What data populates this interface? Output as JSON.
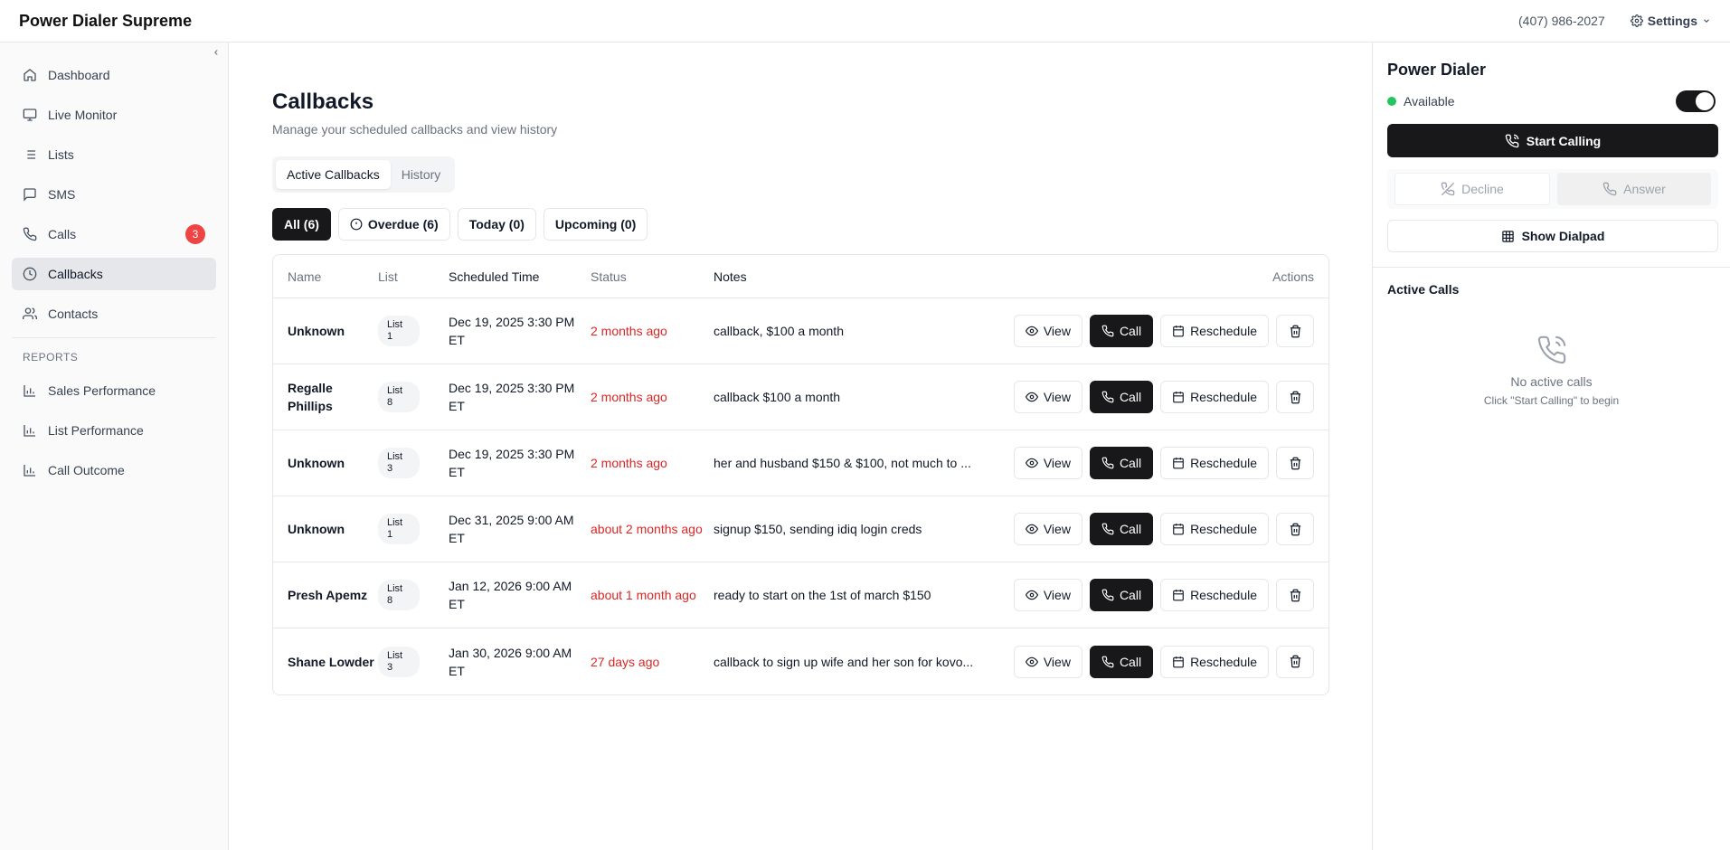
{
  "app": {
    "title": "Power Dialer Supreme"
  },
  "header": {
    "phone": "(407) 986-2027",
    "settings_label": "Settings"
  },
  "sidebar": {
    "items": [
      {
        "label": "Dashboard",
        "icon": "home-icon"
      },
      {
        "label": "Live Monitor",
        "icon": "monitor-icon"
      },
      {
        "label": "Lists",
        "icon": "list-icon"
      },
      {
        "label": "SMS",
        "icon": "message-icon"
      },
      {
        "label": "Calls",
        "icon": "phone-icon",
        "badge": "3"
      },
      {
        "label": "Callbacks",
        "icon": "clock-icon",
        "active": true
      },
      {
        "label": "Contacts",
        "icon": "users-icon"
      }
    ],
    "reports_label": "REPORTS",
    "reports": [
      {
        "label": "Sales Performance",
        "icon": "bar-chart-icon"
      },
      {
        "label": "List Performance",
        "icon": "bar-chart-icon"
      },
      {
        "label": "Call Outcome",
        "icon": "bar-chart-icon"
      }
    ]
  },
  "main": {
    "title": "Callbacks",
    "subtitle": "Manage your scheduled callbacks and view history",
    "tabs": [
      {
        "label": "Active Callbacks",
        "active": true
      },
      {
        "label": "History"
      }
    ],
    "filters": [
      {
        "label": "All (6)",
        "active": true
      },
      {
        "label": "Overdue (6)",
        "icon": "alert-circle-icon"
      },
      {
        "label": "Today (0)"
      },
      {
        "label": "Upcoming (0)"
      }
    ],
    "table": {
      "headers": {
        "name": "Name",
        "list": "List",
        "time": "Scheduled Time",
        "status": "Status",
        "notes": "Notes",
        "actions": "Actions"
      },
      "rows": [
        {
          "name": "Unknown",
          "list": "List 1",
          "time": "Dec 19, 2025 3:30 PM ET",
          "status": "2 months ago",
          "notes": "callback, $100 a month"
        },
        {
          "name": "Regalle Phillips",
          "list": "List 8",
          "time": "Dec 19, 2025 3:30 PM ET",
          "status": "2 months ago",
          "notes": "callback $100 a month"
        },
        {
          "name": "Unknown",
          "list": "List 3",
          "time": "Dec 19, 2025 3:30 PM ET",
          "status": "2 months ago",
          "notes": "her and husband $150 & $100, not much to ..."
        },
        {
          "name": "Unknown",
          "list": "List 1",
          "time": "Dec 31, 2025 9:00 AM ET",
          "status": "about 2 months ago",
          "notes": "signup $150, sending idiq login creds"
        },
        {
          "name": "Presh Apemz",
          "list": "List 8",
          "time": "Jan 12, 2026 9:00 AM ET",
          "status": "about 1 month ago",
          "notes": "ready to start on the 1st of march $150"
        },
        {
          "name": "Shane Lowder",
          "list": "List 3",
          "time": "Jan 30, 2026 9:00 AM ET",
          "status": "27 days ago",
          "notes": "callback to sign up wife and her son for kovo..."
        }
      ],
      "actions": {
        "view": "View",
        "call": "Call",
        "reschedule": "Reschedule"
      }
    }
  },
  "dialer": {
    "title": "Power Dialer",
    "status": "Available",
    "status_color": "#22c55e",
    "start_label": "Start Calling",
    "decline_label": "Decline",
    "answer_label": "Answer",
    "dialpad_label": "Show Dialpad",
    "active_calls_title": "Active Calls",
    "empty_title": "No active calls",
    "empty_hint": "Click \"Start Calling\" to begin"
  },
  "colors": {
    "accent_dark": "#18181b",
    "overdue_red": "#dc2626",
    "badge_red": "#ef4444"
  }
}
